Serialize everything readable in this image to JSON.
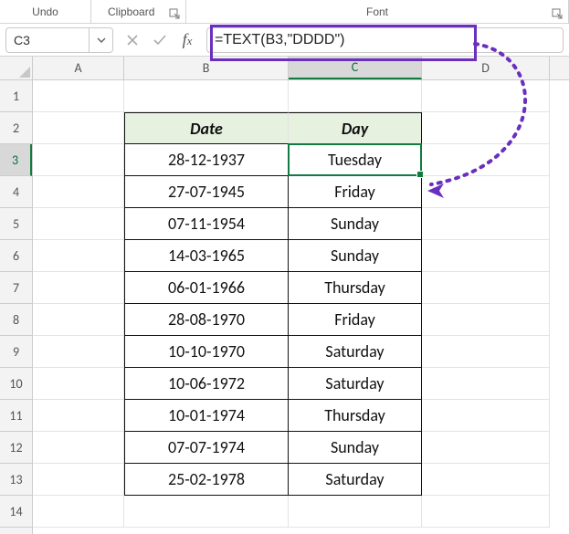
{
  "ribbon": {
    "undo": "Undo",
    "clipboard": "Clipboard",
    "font": "Font"
  },
  "formula_bar": {
    "namebox_value": "C3",
    "formula_value": "=TEXT(B3,\"DDDD\")"
  },
  "columns": [
    "A",
    "B",
    "C",
    "D"
  ],
  "row_count": 14,
  "active_cell": "C3",
  "chart_data": {
    "type": "table",
    "title": "",
    "headers": [
      "Date",
      "Day"
    ],
    "rows": [
      [
        "28-12-1937",
        "Tuesday"
      ],
      [
        "27-07-1945",
        "Friday"
      ],
      [
        "07-11-1954",
        "Sunday"
      ],
      [
        "14-03-1965",
        "Sunday"
      ],
      [
        "06-01-1966",
        "Thursday"
      ],
      [
        "28-08-1970",
        "Friday"
      ],
      [
        "10-10-1970",
        "Saturday"
      ],
      [
        "10-06-1972",
        "Saturday"
      ],
      [
        "10-01-1974",
        "Thursday"
      ],
      [
        "07-07-1974",
        "Sunday"
      ],
      [
        "25-02-1978",
        "Saturday"
      ]
    ]
  }
}
